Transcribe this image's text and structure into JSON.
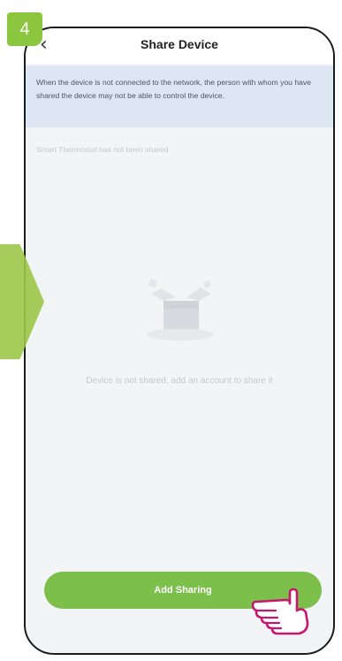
{
  "step_number": "4",
  "header": {
    "title": "Share Device",
    "back_icon": "chevron-left-icon"
  },
  "notice": {
    "text": "When the device is not connected to the network, the person with whom you have shared the device may not be able to control the device."
  },
  "status": {
    "text": "Smart Thermostat has not been shared"
  },
  "empty_state": {
    "illustration_icon": "empty-box-icon",
    "message": "Device is not shared, add an account to share it"
  },
  "actions": {
    "add_sharing_label": "Add Sharing"
  },
  "colors": {
    "accent_green": "#7cc04b",
    "notice_background": "#dde7f3",
    "step_badge": "#8cc63f",
    "side_arrow": "#9cc84a"
  }
}
